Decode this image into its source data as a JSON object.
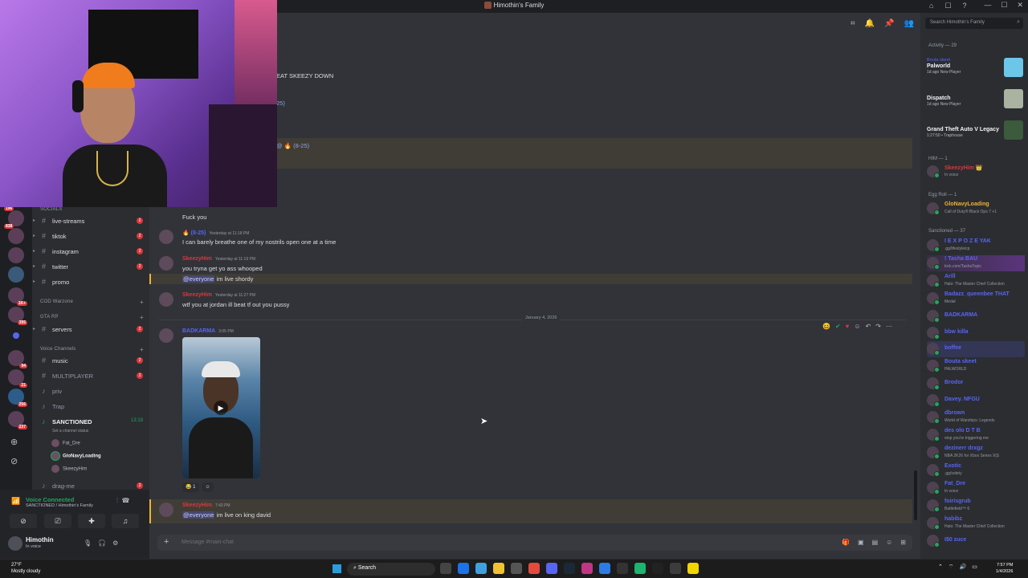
{
  "window": {
    "title": "Himothin's Family",
    "controls": [
      "—",
      "☐",
      "✕"
    ],
    "top_icons": [
      "⌂",
      "☐",
      "?"
    ]
  },
  "server_rail": {
    "badges": [
      "196",
      "838",
      "1K+",
      "395",
      "94",
      "21",
      "256",
      "237"
    ]
  },
  "channels": {
    "socials_label": "SOCIALS",
    "items": [
      {
        "name": "live-streams",
        "badge": "2"
      },
      {
        "name": "tiktok",
        "badge": "2"
      },
      {
        "name": "instagram",
        "badge": "2"
      },
      {
        "name": "twitter",
        "badge": "2"
      },
      {
        "name": "promo",
        "badge": ""
      }
    ],
    "cat_cod": "COD Warzone",
    "cat_gta": "GTA RP",
    "servers": {
      "name": "servers",
      "badge": "2"
    },
    "cat_voice": "Voice Channels",
    "voice_items": [
      {
        "name": "music",
        "badge": "2"
      },
      {
        "name": "MULTIPLAYER",
        "badge": "2"
      },
      {
        "name": "priv",
        "badge": ""
      },
      {
        "name": "Trap",
        "badge": ""
      }
    ],
    "sanctioned": {
      "name": "SANCTIONED",
      "time": "13:19",
      "status": "Set a channel status"
    },
    "voice_users": [
      "Fat_Dre",
      "GloNavyLoading",
      "SkeezyHim"
    ],
    "drag": {
      "name": "drag-me",
      "badge": "2"
    }
  },
  "user_panel": {
    "voice_title": "Voice Connected",
    "voice_sub": "SANCTIONED / Himothin's Family",
    "name": "Himothin",
    "status": "In voice"
  },
  "chat": {
    "partial_lines": [
      "EAT SKEEZY DOWN",
      "25)",
      "@ 🔥 (8-25)"
    ],
    "messages": [
      {
        "author": "",
        "time": "",
        "color": "#5865f2",
        "text": "Fuck you"
      },
      {
        "author": "🔥 (8-25)",
        "time": "Yesterday at 11:18 PM",
        "color": "#5865f2",
        "text": "I can barely breathe one of my nostrils open one at a time"
      },
      {
        "author": "SkeezyHim",
        "time": "Yesterday at 11:19 PM",
        "color": "#da373c",
        "text": "you tryna get yo ass whooped",
        "mention": "@everyone",
        "mention_text": " im live shordy"
      },
      {
        "author": "SkeezyHim",
        "time": "Yesterday at 11:27 PM",
        "color": "#da373c",
        "text": "wtf you at jordan ill beat tf out you pussy"
      },
      {
        "author": "BADKARMA",
        "time": "3:05 PM",
        "color": "#5865f2"
      },
      {
        "author": "SkeezyHim",
        "time": "7:43 PM",
        "color": "#da373c",
        "mention": "@everyone",
        "mention_text": " im live on king david"
      }
    ],
    "date_divider": "January 4, 2026",
    "reaction": {
      "emoji": "😂",
      "count": "1"
    },
    "composer_placeholder": "Message #main-chat"
  },
  "members": {
    "search_placeholder": "Search Himothin's Family",
    "activity_header": "Activity — 29",
    "activities": [
      {
        "user": "Bouta skeet",
        "game": "Palworld",
        "meta": "1d ago  New Player",
        "red": false
      },
      {
        "user": "",
        "game": "Dispatch",
        "meta": "1d ago  New Player",
        "red": true
      },
      {
        "user": "",
        "game": "Grand Theft Auto V Legacy",
        "meta": "1:27:50  • Traphouse",
        "red": true
      }
    ],
    "him_header": "HIM — 1",
    "him": [
      {
        "name": "SkeezyHim 👑",
        "status": "In voice",
        "color": "#da373c"
      }
    ],
    "egg_header": "Egg Roll — 1",
    "egg": [
      {
        "name": "GloNavyLoading",
        "status": "Call of Duty® Black Ops 7 +1",
        "color": "#f0b232"
      }
    ],
    "sanct_header": "Sanctioned — 37",
    "sanctioned": [
      {
        "name": "I E X P O Z E  YAK",
        "status": ".gg/lifestyleicp"
      },
      {
        "name": "! Tasha  BAU",
        "status": "kick.com/TashaTopic"
      },
      {
        "name": "Arill",
        "status": "Halo: The Master Chief Collection"
      },
      {
        "name": "Badazz_queenbee  THAT",
        "status": "Medal"
      },
      {
        "name": "BADKARMA",
        "status": ""
      },
      {
        "name": "bbw killa",
        "status": ""
      },
      {
        "name": "boffee",
        "status": ""
      },
      {
        "name": "Bouta skeet",
        "status": "PALWORLD"
      },
      {
        "name": "Brodor",
        "status": ""
      },
      {
        "name": "Davey.  NFGU",
        "status": ""
      },
      {
        "name": "dbrown",
        "status": "World of Warships: Legends"
      },
      {
        "name": "des olo  D T B",
        "status": "stop you're triggering me"
      },
      {
        "name": "dezinerr drxgz",
        "status": "NBA 2K26 for Xbox Series X|S"
      },
      {
        "name": "Exotic",
        "status": ".gg/sobriy"
      },
      {
        "name": "Fat_Dre",
        "status": "In voice"
      },
      {
        "name": "foirisgrub",
        "status": "Battlefield™ 6"
      },
      {
        "name": "habibz",
        "status": "Halo: The Master Chief Collection"
      },
      {
        "name": "I$0 zuce",
        "status": ""
      }
    ]
  },
  "taskbar": {
    "temp": "27°F",
    "weather": "Mostly cloudy",
    "search": "Search",
    "time": "7:57 PM",
    "date": "1/4/2026"
  }
}
